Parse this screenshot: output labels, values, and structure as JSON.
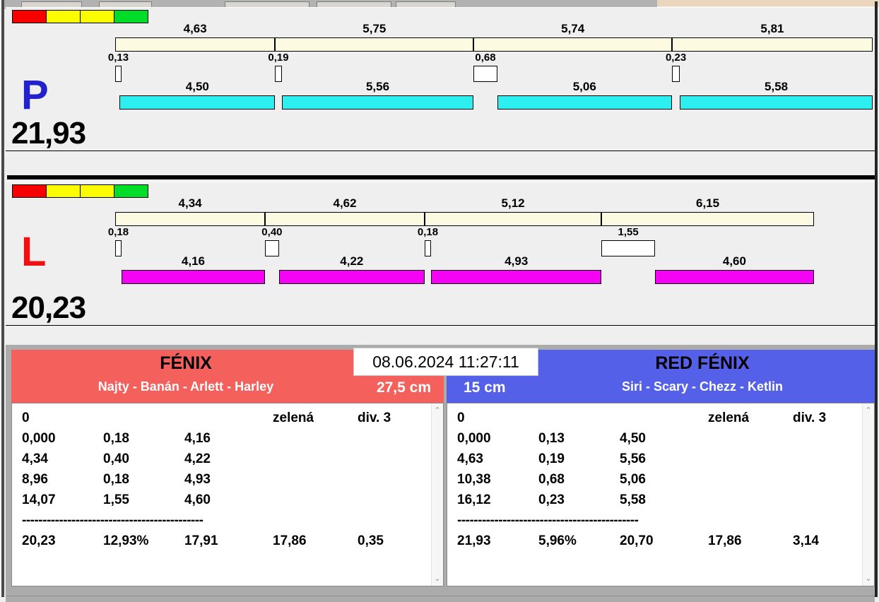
{
  "timestamp": "08.06.2024 11:27:11",
  "status_strip": {
    "colors": [
      "#F80000",
      "#FCFC00",
      "#FCFC00",
      "#00DC28"
    ]
  },
  "lanes": [
    {
      "letter": "P",
      "letter_color": "#2222CC",
      "total": "21,93",
      "bar_color": "#2EEFEF",
      "segments": [
        {
          "split_label": "4,63",
          "split": 4.63,
          "exch_label": "0,13",
          "exch": 0.13,
          "run_label": "4,50",
          "run": 4.5
        },
        {
          "split_label": "5,75",
          "split": 5.75,
          "exch_label": "0,19",
          "exch": 0.19,
          "run_label": "5,56",
          "run": 5.56
        },
        {
          "split_label": "5,74",
          "split": 5.74,
          "exch_label": "0,68",
          "exch": 0.68,
          "run_label": "5,06",
          "run": 5.06
        },
        {
          "split_label": "5,81",
          "split": 5.81,
          "exch_label": "0,23",
          "exch": 0.23,
          "run_label": "5,58",
          "run": 5.58
        }
      ]
    },
    {
      "letter": "L",
      "letter_color": "#EE1111",
      "total": "20,23",
      "bar_color": "#F503F5",
      "segments": [
        {
          "split_label": "4,34",
          "split": 4.34,
          "exch_label": "0,18",
          "exch": 0.18,
          "run_label": "4,16",
          "run": 4.16
        },
        {
          "split_label": "4,62",
          "split": 4.62,
          "exch_label": "0,40",
          "exch": 0.4,
          "run_label": "4,22",
          "run": 4.22
        },
        {
          "split_label": "5,12",
          "split": 5.12,
          "exch_label": "0,18",
          "exch": 0.18,
          "run_label": "4,93",
          "run": 4.93
        },
        {
          "split_label": "6,15",
          "split": 6.15,
          "exch_label": "1,55",
          "exch": 1.55,
          "run_label": "4,60",
          "run": 4.6
        }
      ]
    }
  ],
  "teams": [
    {
      "name": "FÉNIX",
      "header_color": "#F4615C",
      "dogs": "Najty - Banán - Arlett - Harley",
      "size": "27,5 cm",
      "info_row": {
        "c1": "0",
        "c4": "zelená",
        "c5": "div. 3"
      },
      "rows": [
        [
          "0,000",
          "0,18",
          "4,16"
        ],
        [
          "4,34",
          "0,40",
          "4,22"
        ],
        [
          "8,96",
          "0,18",
          "4,93"
        ],
        [
          "14,07",
          "1,55",
          "4,60"
        ]
      ],
      "dashes": "--------------------------------------------",
      "totals": [
        "20,23",
        "12,93%",
        "17,91",
        "17,86",
        "0,35"
      ]
    },
    {
      "name": "RED FÉNIX",
      "header_color": "#5560E8",
      "dogs": "Siri - Scary - Chezz - Ketlin",
      "size": "15 cm",
      "info_row": {
        "c1": "0",
        "c4": "zelená",
        "c5": "div. 3"
      },
      "rows": [
        [
          "0,000",
          "0,13",
          "4,50"
        ],
        [
          "4,63",
          "0,19",
          "5,56"
        ],
        [
          "10,38",
          "0,68",
          "5,06"
        ],
        [
          "16,12",
          "0,23",
          "5,58"
        ]
      ],
      "dashes": "--------------------------------------------",
      "totals": [
        "21,93",
        "5,96%",
        "20,70",
        "17,86",
        "3,14"
      ]
    }
  ]
}
